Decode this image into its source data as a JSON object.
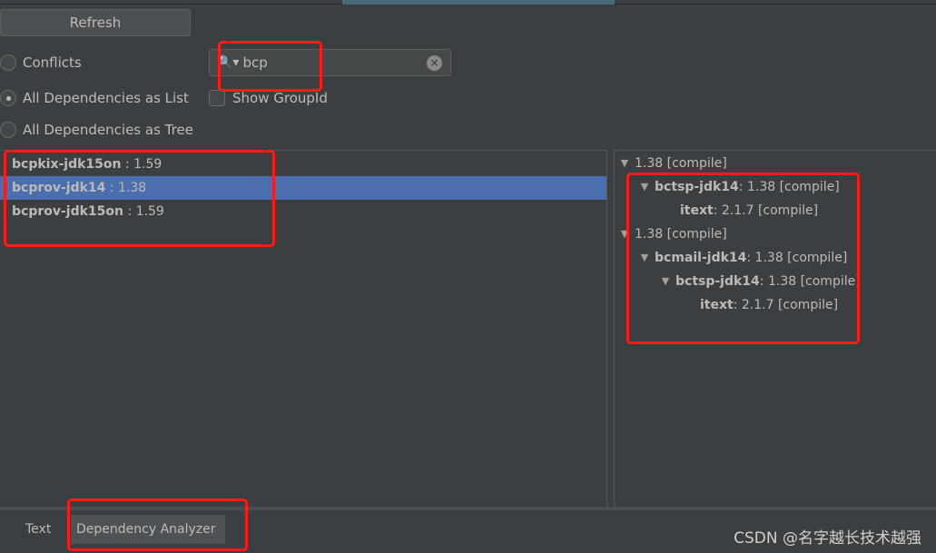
{
  "toolbar": {
    "refresh_label": "Refresh"
  },
  "view_modes": [
    {
      "label": "Conflicts",
      "selected": false
    },
    {
      "label": "All Dependencies as List",
      "selected": true
    },
    {
      "label": "All Dependencies as Tree",
      "selected": false
    }
  ],
  "search": {
    "value": "bcp",
    "show_groupid_label": "Show GroupId",
    "show_groupid_checked": false
  },
  "dependency_list": [
    {
      "name": "bcpkix-jdk15on",
      "version": " : 1.59",
      "selected": false
    },
    {
      "name": "bcprov-jdk14",
      "version": " : 1.38",
      "selected": true
    },
    {
      "name": "bcprov-jdk15on",
      "version": " : 1.59",
      "selected": false
    }
  ],
  "usage_tree": [
    {
      "level": 0,
      "expanded": true,
      "name": "",
      "detail": "1.38 [compile]"
    },
    {
      "level": 1,
      "expanded": true,
      "name": "bctsp-jdk14",
      "detail": " : 1.38 [compile]"
    },
    {
      "level": 2,
      "expanded": null,
      "name": "itext",
      "detail": " : 2.1.7 [compile]"
    },
    {
      "level": 0,
      "expanded": true,
      "name": "",
      "detail": "1.38 [compile]"
    },
    {
      "level": 1,
      "expanded": true,
      "name": "bcmail-jdk14",
      "detail": " : 1.38 [compile]"
    },
    {
      "level": 2,
      "expanded": true,
      "name": "bctsp-jdk14",
      "detail": " : 1.38 [compile]"
    },
    {
      "level": 3,
      "expanded": null,
      "name": "itext",
      "detail": " : 2.1.7 [compile]"
    }
  ],
  "bottom_tabs": [
    {
      "label": "Text",
      "active": false
    },
    {
      "label": "Dependency Analyzer",
      "active": true
    }
  ],
  "watermark": "CSDN @名字越长技术越强",
  "colors": {
    "background": "#3c3f41",
    "selection": "#4b6eaf",
    "annotation": "#ff1a1a"
  }
}
